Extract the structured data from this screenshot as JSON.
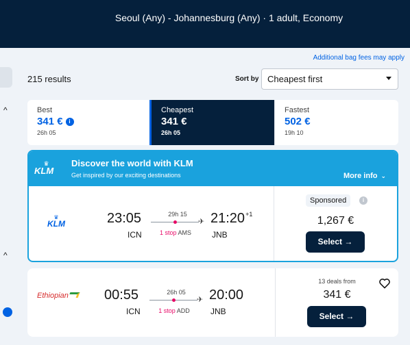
{
  "header": {
    "search_summary": "Seoul (Any) - Johannesburg (Any)  ·  1 adult, Economy"
  },
  "notices": {
    "bag_fees": "Additional bag fees may apply"
  },
  "results": {
    "count": "215 results",
    "sort_label": "Sort by",
    "sort_value": "Cheapest first"
  },
  "tabs": [
    {
      "label": "Best",
      "price": "341 €",
      "duration": "26h 05",
      "selected": false
    },
    {
      "label": "Cheapest",
      "price": "341 €",
      "duration": "26h 05",
      "selected": true
    },
    {
      "label": "Fastest",
      "price": "502 €",
      "duration": "19h 10",
      "selected": false
    }
  ],
  "promo": {
    "logo_text": "KLM",
    "title": "Discover the world with KLM",
    "subtitle": "Get inspired by our exciting destinations",
    "more_info": "More info"
  },
  "flights": [
    {
      "airline": "KLM",
      "dep_time": "23:05",
      "dep_code": "ICN",
      "arr_time": "21:20",
      "arr_day_offset": "+1",
      "arr_code": "JNB",
      "duration": "29h 15",
      "stop_count": "1 stop",
      "stop_airport": "AMS",
      "badge": "Sponsored",
      "price": "1,267 €",
      "select_label": "Select →"
    },
    {
      "airline": "Ethiopian",
      "dep_time": "00:55",
      "dep_code": "ICN",
      "arr_time": "20:00",
      "arr_code": "JNB",
      "duration": "26h 05",
      "stop_count": "1 stop",
      "stop_airport": "ADD",
      "deals": "13 deals from",
      "price": "341 €",
      "select_label": "Select →"
    }
  ],
  "colors": {
    "navy": "#05203c",
    "blue": "#0062e3",
    "promo_blue": "#1aa2dd",
    "stop_pink": "#e70866"
  }
}
